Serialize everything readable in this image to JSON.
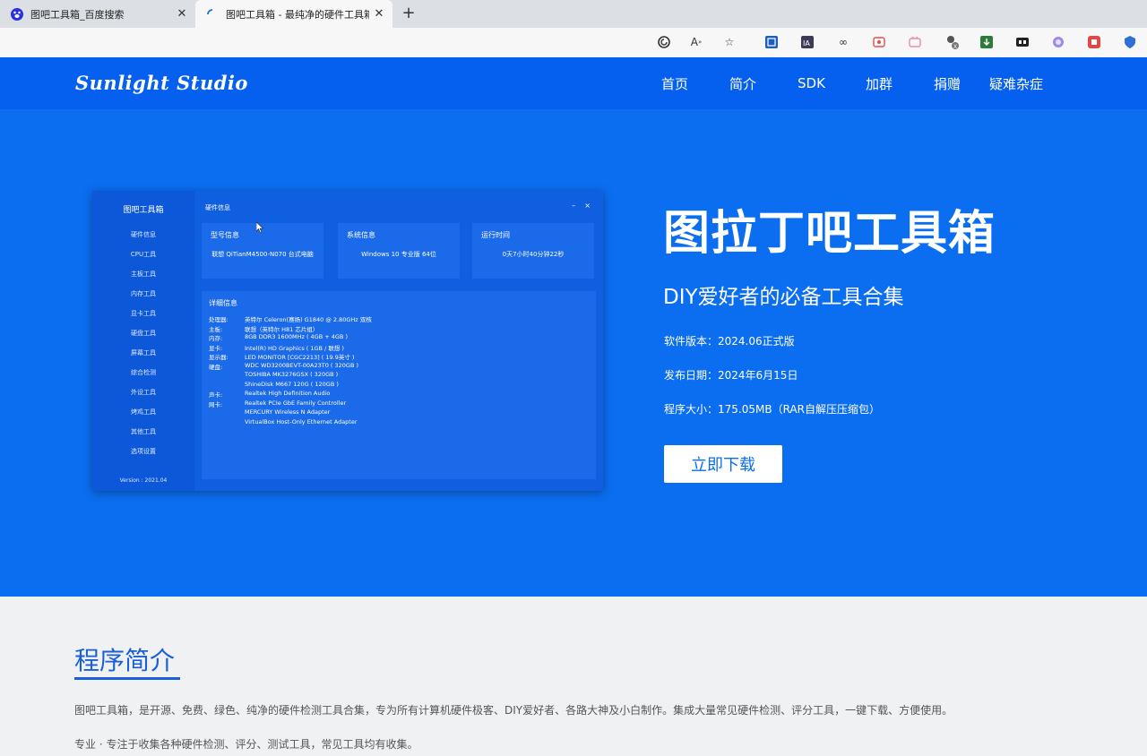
{
  "browser": {
    "tabs": [
      {
        "title": "图吧工具箱_百度搜索",
        "icon": "baidu-paw-icon"
      },
      {
        "title": "图吧工具箱 - 最纯净的硬件工具箱",
        "icon": "loading-spinner-icon"
      }
    ],
    "new_tab": "+",
    "close": "✕",
    "toolbar_icons": [
      "edge-refresh-icon",
      "read-aloud-icon",
      "favorite-star-icon",
      "ext-translate-icon",
      "ext-ia-icon",
      "ext-infinity-icon",
      "ext-red-icon",
      "ext-pink-icon",
      "ext-user-icon",
      "ext-green-icon",
      "ext-black-icon",
      "ext-purple-icon",
      "ext-red2-icon",
      "ext-shield-icon"
    ]
  },
  "site": {
    "logo": "Sunlight Studio",
    "nav": [
      "首页",
      "简介",
      "SDK",
      "加群",
      "捐赠",
      "疑难杂症"
    ]
  },
  "app_screenshot": {
    "title": "图吧工具箱",
    "main_title": "硬件信息",
    "win_min": "–",
    "win_close": "×",
    "menu": [
      "硬件信息",
      "CPU工具",
      "主板工具",
      "内存工具",
      "显卡工具",
      "硬盘工具",
      "屏幕工具",
      "综合检测",
      "外设工具",
      "烤鸡工具",
      "其他工具",
      "选项设置"
    ],
    "version": "Version : 2021.04",
    "cards": [
      {
        "title": "型号信息",
        "value": "联想 QiTianM4500-N070 台式电脑"
      },
      {
        "title": "系统信息",
        "value": "Windows 10 专业版 64位"
      },
      {
        "title": "运行时间",
        "value": "0天7小时40分钟22秒"
      }
    ],
    "detail_title": "详细信息",
    "detail_rows": [
      {
        "k": "处理器:",
        "v": "英特尔 Celeron(赛扬) G1840 @ 2.80GHz 双核"
      },
      {
        "k": "主板:",
        "v": "联想（英特尔 H81 芯片组）"
      },
      {
        "k": "内存:",
        "v": "8GB DDR3 1600MHz ( 4GB + 4GB )"
      },
      {
        "k": "显卡:",
        "v": "Intel(R) HD Graphics ( 1GB / 联想 )"
      },
      {
        "k": "显示器:",
        "v": "LED MONITOR [CGC2213] ( 19.9英寸 )"
      },
      {
        "k": "硬盘:",
        "v": "WDC WD3200BEVT-00A23T0 ( 320GB )"
      },
      {
        "k": "",
        "v": "TOSHIBA MK3276GSX ( 320GB )"
      },
      {
        "k": "",
        "v": "ShineDisk M667 120G ( 120GB )"
      },
      {
        "k": "声卡:",
        "v": "Realtek High Definition Audio"
      },
      {
        "k": "网卡:",
        "v": "Realtek PCIe GbE Family Controller"
      },
      {
        "k": "",
        "v": "MERCURY Wireless N Adapter"
      },
      {
        "k": "",
        "v": "VirtualBox Host-Only Ethernet Adapter"
      }
    ]
  },
  "hero": {
    "title": "图拉丁吧工具箱",
    "subtitle": "DIY爱好者的必备工具合集",
    "version": "软件版本：2024.06正式版",
    "date": "发布日期：2024年6月15日",
    "size": "程序大小：175.05MB（RAR自解压压缩包）",
    "download": "立即下载"
  },
  "intro": {
    "heading": "程序简介",
    "p1": "图吧工具箱，是开源、免费、绿色、纯净的硬件检测工具合集，专为所有计算机硬件极客、DIY爱好者、各路大神及小白制作。集成大量常见硬件检测、评分工具，一键下载、方便使用。",
    "p2": "专业 · 专注于收集各种硬件检测、评分、测试工具，常见工具均有收集。"
  },
  "colors": {
    "header_blue": "#0660ef",
    "hero_blue": "#0b6ef0",
    "accent": "#1a5fd6"
  }
}
